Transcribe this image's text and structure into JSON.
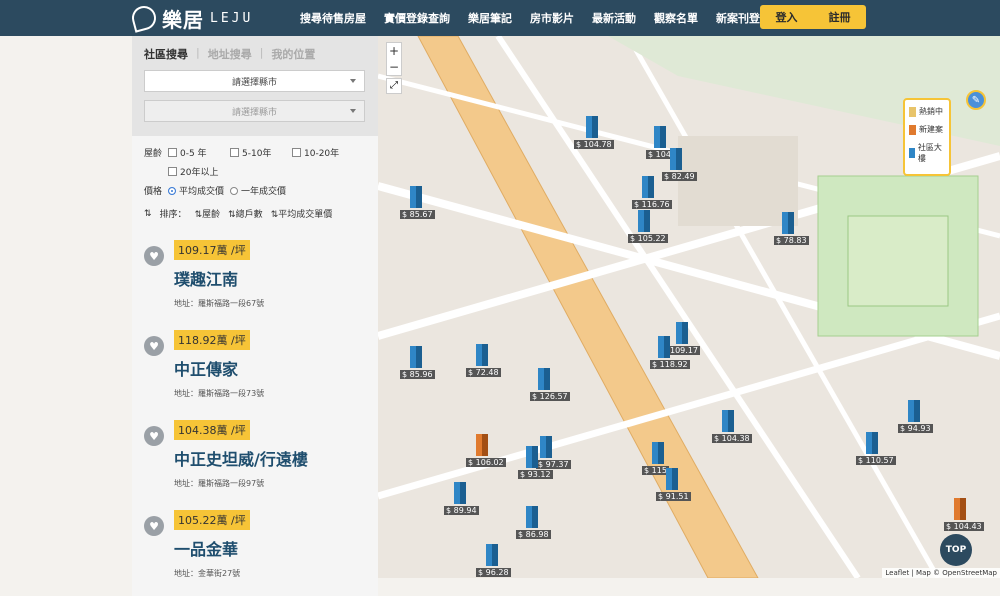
{
  "header": {
    "logo_cn": "樂居",
    "logo_en": "LEJU",
    "nav": [
      "搜尋待售房屋",
      "實價登錄查詢",
      "樂居筆記",
      "房市影片",
      "最新活動",
      "觀察名單",
      "新案刊登"
    ],
    "login": "登入",
    "register": "註冊"
  },
  "sidebar": {
    "tabs": [
      "社區搜尋",
      "地址搜尋",
      "我的位置"
    ],
    "county_select": "請選擇縣市",
    "district_select": "請選擇縣市",
    "age_label": "屋齡",
    "age_options": [
      "0-5 年",
      "5-10年",
      "10-20年",
      "20年以上"
    ],
    "price_label": "價格",
    "price_options": [
      "平均成交價",
      "一年成交價"
    ],
    "sort_label": "排序：",
    "sort_options": [
      "屋齡",
      "總戶數",
      "平均成交單價"
    ],
    "listings": [
      {
        "price": "109.17萬 /坪",
        "name": "璞趣江南",
        "address": "地址：羅斯福路一段67號"
      },
      {
        "price": "118.92萬 /坪",
        "name": "中正傳家",
        "address": "地址：羅斯福路一段73號"
      },
      {
        "price": "104.38萬 /坪",
        "name": "中正史坦威/行遠樓",
        "address": "地址：羅斯福路一段97號"
      },
      {
        "price": "105.22萬 /坪",
        "name": "一品金華",
        "address": "地址：金華街27號"
      }
    ]
  },
  "map": {
    "zoom_in": "+",
    "zoom_out": "−",
    "fullscreen": "⤢",
    "legend": [
      "熱銷中",
      "新建案",
      "社區大樓"
    ],
    "top_button": "TOP",
    "attribution": "Leaflet | Map © OpenStreetMap",
    "pins": [
      {
        "label": "$ 104.78",
        "type": "blue"
      },
      {
        "label": "$ 104.",
        "type": "blue"
      },
      {
        "label": "$ 82.49",
        "type": "blue"
      },
      {
        "label": "$ 85.67",
        "type": "blue"
      },
      {
        "label": "$ 116.76",
        "type": "blue"
      },
      {
        "label": "$ 105.22",
        "type": "blue"
      },
      {
        "label": "$ 78.83",
        "type": "blue"
      },
      {
        "label": "$ 85.96",
        "type": "blue"
      },
      {
        "label": "$ 72.48",
        "type": "blue"
      },
      {
        "label": "109.17",
        "type": "blue"
      },
      {
        "label": "$ 118.92",
        "type": "blue"
      },
      {
        "label": "$ 126.57",
        "type": "blue"
      },
      {
        "label": "$ 104.38",
        "type": "blue"
      },
      {
        "label": "$ 94.93",
        "type": "blue"
      },
      {
        "label": "$ 106.02",
        "type": "orange"
      },
      {
        "label": "$ 97.37",
        "type": "blue"
      },
      {
        "label": "$ 93.12",
        "type": "blue"
      },
      {
        "label": "$ 115",
        "type": "blue"
      },
      {
        "label": "$ 110.57",
        "type": "blue"
      },
      {
        "label": "$ 91.51",
        "type": "blue"
      },
      {
        "label": "$ 89.94",
        "type": "blue"
      },
      {
        "label": "$ 86.98",
        "type": "blue"
      },
      {
        "label": "$ 104.43",
        "type": "orange"
      },
      {
        "label": "$ 96.28",
        "type": "blue"
      }
    ]
  }
}
